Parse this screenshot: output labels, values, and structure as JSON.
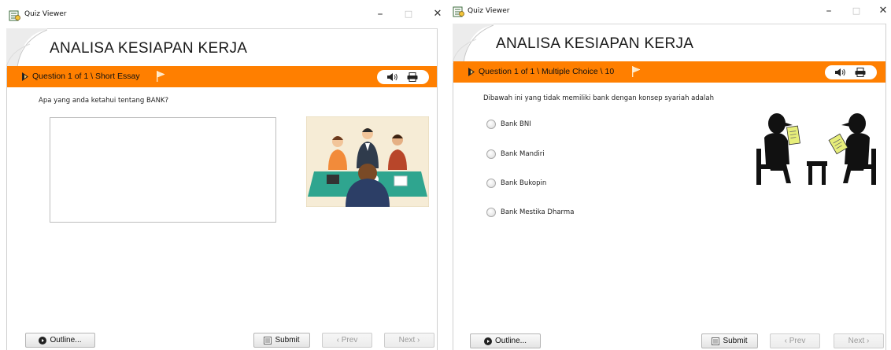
{
  "left": {
    "window_title": "Quiz Viewer",
    "quiz_title": "ANALISA KESIAPAN KERJA",
    "question_label": "Question 1 of 1 \\ Short Essay",
    "question_text": "Apa yang anda ketahui tentang BANK?",
    "answer_value": "",
    "buttons": {
      "outline": "Outline...",
      "submit": "Submit",
      "prev": "‹ Prev",
      "next": "Next ›"
    }
  },
  "right": {
    "window_title": "Quiz Viewer",
    "quiz_title": "ANALISA KESIAPAN KERJA",
    "question_label": "Question 1 of 1 \\ Multiple Choice \\ 10",
    "question_text": "Dibawah ini yang tidak memiliki bank dengan konsep syariah adalah",
    "choices": [
      "Bank BNI",
      "Bank Mandiri",
      "Bank Bukopin",
      "Bank Mestika Dharma"
    ],
    "buttons": {
      "outline": "Outline...",
      "submit": "Submit",
      "prev": "‹ Prev",
      "next": "Next ›"
    }
  },
  "window_controls": {
    "minimize": "–",
    "maximize": "□",
    "close": "✕"
  },
  "colors": {
    "accent": "#ff7f00",
    "button_border": "#b5b5b5",
    "disabled_text": "#9a9a9a"
  },
  "icons": [
    "quiz-viewer-app-icon",
    "page-curl-icon",
    "arrow-icon",
    "flag-icon",
    "speaker-icon",
    "printer-icon",
    "play-icon",
    "list-icon"
  ]
}
